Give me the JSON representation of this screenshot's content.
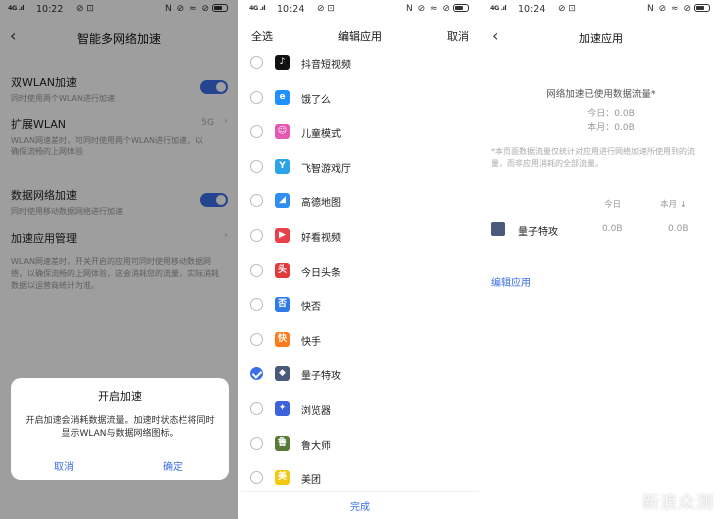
{
  "panel1": {
    "status": {
      "signal": "4G .ıl",
      "time": "10:22",
      "left_icons": "⊘ ⊡",
      "right_icons": "N ⊘ ≈ ⊘"
    },
    "title": "智能多网络加速",
    "rows": [
      {
        "label": "双WLAN加速",
        "sub": "同时使用两个WLAN进行加速",
        "toggle": true
      },
      {
        "label": "扩展WLAN",
        "value": "5G",
        "sub": "WLAN网速差时，可同时使用两个WLAN进行加速，以确保流畅的上网体验"
      },
      {
        "label": "数据网络加速",
        "sub": "同时使用移动数据网络进行加速",
        "toggle": true
      },
      {
        "label": "加速应用管理"
      }
    ],
    "footnote": "WLAN网速差时，开关开启的应用可同时使用移动数据网络，以确保流畅的上网体验，这会消耗您的流量，实际消耗数据以运营商统计为准。",
    "dialog": {
      "title": "开启加速",
      "message": "开启加速会消耗数据流量。加速时状态栏将同时显示WLAN与数据网络图标。",
      "cancel": "取消",
      "confirm": "确定"
    }
  },
  "panel2": {
    "status": {
      "signal": "4G .ıl",
      "time": "10:24",
      "left_icons": "⊘ ⊡",
      "right_icons": "N ⊘ ≈ ⊘"
    },
    "select_all": "全选",
    "title": "编辑应用",
    "cancel": "取消",
    "apps": [
      {
        "name": "抖音短视频",
        "checked": false,
        "icon_color": "#111111",
        "icon_text": "♪"
      },
      {
        "name": "饿了么",
        "checked": false,
        "icon_color": "#1e90ff",
        "icon_text": "e"
      },
      {
        "name": "儿童模式",
        "checked": false,
        "icon_color": "#e45ab0",
        "icon_text": "☺"
      },
      {
        "name": "飞智游戏厅",
        "checked": false,
        "icon_color": "#2aa4e6",
        "icon_text": "Y"
      },
      {
        "name": "高德地图",
        "checked": false,
        "icon_color": "#2f8ef0",
        "icon_text": "◢"
      },
      {
        "name": "好看视频",
        "checked": false,
        "icon_color": "#e8414b",
        "icon_text": "▶"
      },
      {
        "name": "今日头条",
        "checked": false,
        "icon_color": "#e33b3b",
        "icon_text": "头"
      },
      {
        "name": "快否",
        "checked": false,
        "icon_color": "#2f7ae5",
        "icon_text": "否"
      },
      {
        "name": "快手",
        "checked": false,
        "icon_color": "#ff7a1a",
        "icon_text": "快"
      },
      {
        "name": "量子特攻",
        "checked": true,
        "icon_color": "#4a5a7a",
        "icon_text": "◆"
      },
      {
        "name": "浏览器",
        "checked": false,
        "icon_color": "#3d63d8",
        "icon_text": "✦"
      },
      {
        "name": "鲁大师",
        "checked": false,
        "icon_color": "#5a7a3a",
        "icon_text": "鲁"
      },
      {
        "name": "美团",
        "checked": false,
        "icon_color": "#f2c811",
        "icon_text": "美"
      }
    ],
    "done": "完成"
  },
  "panel3": {
    "status": {
      "signal": "4G .ıl",
      "time": "10:24",
      "left_icons": "⊘ ⊡",
      "right_icons": "N ⊘ ≈ ⊘"
    },
    "title": "加速应用",
    "used_title": "网络加速已使用数据流量*",
    "today_line": "今日：0.0B",
    "month_line": "本月：0.0B",
    "note": "*本页面数据流量仅统计对应用进行网络加速所使用到的流量，而非应用消耗的全部流量。",
    "col_today": "今日",
    "col_month": "本月 ↓",
    "app": {
      "name": "量子特攻",
      "today": "0.0B",
      "month": "0.0B"
    },
    "edit": "编辑应用",
    "watermark": "新浪众测"
  }
}
